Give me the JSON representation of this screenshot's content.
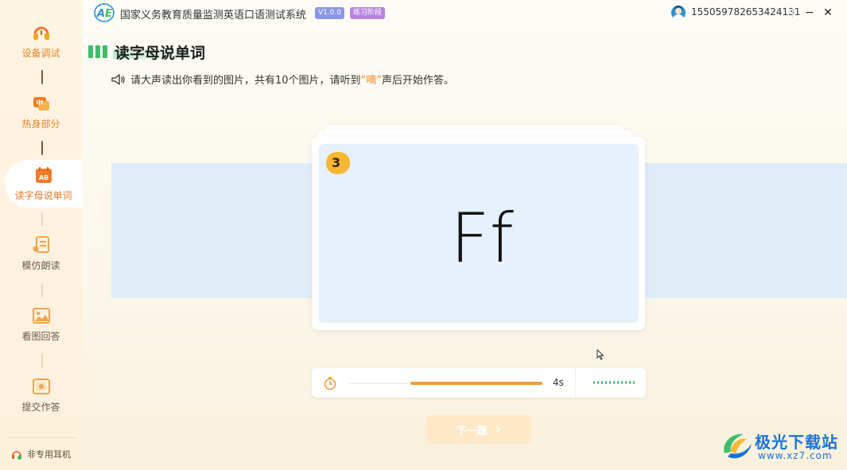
{
  "window": {
    "title": "国家义务教育质量监测英语口语测试系统",
    "version": "V1.0.0",
    "stage": "练习阶段",
    "user_id": "155059782653424131",
    "minimize_label": "−",
    "close_label": "✕"
  },
  "sidebar": {
    "items": [
      {
        "label": "设备调试",
        "icon": "headset-icon",
        "state": "done"
      },
      {
        "label": "热身部分",
        "icon": "voice-chat-icon",
        "state": "done"
      },
      {
        "label": "读字母说单词",
        "icon": "ab-calendar-icon",
        "state": "active"
      },
      {
        "label": "模仿朗读",
        "icon": "read-aloud-icon",
        "state": "pending"
      },
      {
        "label": "看图回答",
        "icon": "picture-icon",
        "state": "pending"
      },
      {
        "label": "提交作答",
        "icon": "submit-icon",
        "state": "pending"
      }
    ],
    "footer_label": "非专用耳机"
  },
  "section": {
    "title": "读字母说单词",
    "instruction_prefix": "请大声读出你看到的图片，共有10个图片，请听到",
    "instruction_highlight": "“嘀”",
    "instruction_suffix": "声后开始作答。"
  },
  "card": {
    "question_number": "3",
    "content": "Ff"
  },
  "timer": {
    "remaining_label": "4s",
    "progress": 0.68
  },
  "next_button": {
    "label": "下一题",
    "arrow": "›"
  },
  "watermark": {
    "title": "极光下载站",
    "url": "www.xz7.com"
  },
  "colors": {
    "accent_orange": "#f39b3a",
    "section_green": "#3fbe6a",
    "band_blue": "#e0edf9",
    "watermark_blue": "#1a73d8"
  }
}
